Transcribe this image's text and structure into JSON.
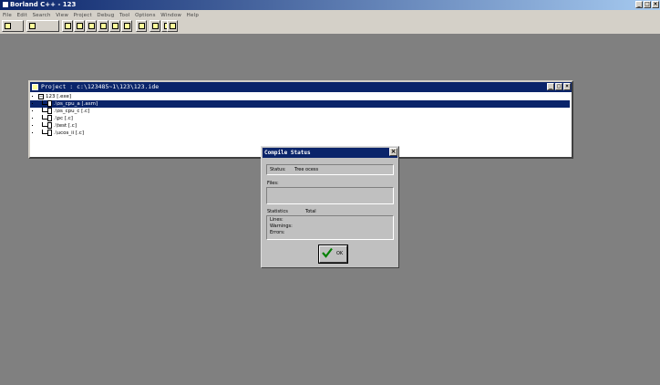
{
  "app": {
    "title": "Borland C++ - 123",
    "window_buttons": [
      "_",
      "□",
      "×"
    ]
  },
  "menu": {
    "items": [
      "File",
      "Edit",
      "Search",
      "View",
      "Project",
      "Debug",
      "Tool",
      "Options",
      "Window",
      "Help"
    ]
  },
  "project_window": {
    "title": "Project : c:\\123485~1\\123\\123.ide",
    "buttons": [
      "_",
      "□",
      "×"
    ],
    "tree": {
      "root": "123 [.exe]",
      "children": [
        ".\\os_cpu_a [.asm]",
        ".\\os_cpu_c [.c]",
        ".\\pc [.c]",
        ".\\test [.c]",
        ".\\ucos_ii [.c]"
      ],
      "selected_index": 0
    }
  },
  "compile_status": {
    "title": "Compile Status",
    "close": "×",
    "status_label": "Status:",
    "status_value": "Tree ocess",
    "files_label": "Files:",
    "statistics_label": "Statistics",
    "total_label": "Total",
    "lines_label": "Lines:",
    "warnings_label": "Warnings:",
    "errors_label": "Errors:",
    "ok_label": "OK"
  },
  "colors": {
    "desktop": "#808080",
    "title_active": "#0a246a",
    "dialog_face": "#c0c0c0",
    "ok_check": "#008000"
  }
}
